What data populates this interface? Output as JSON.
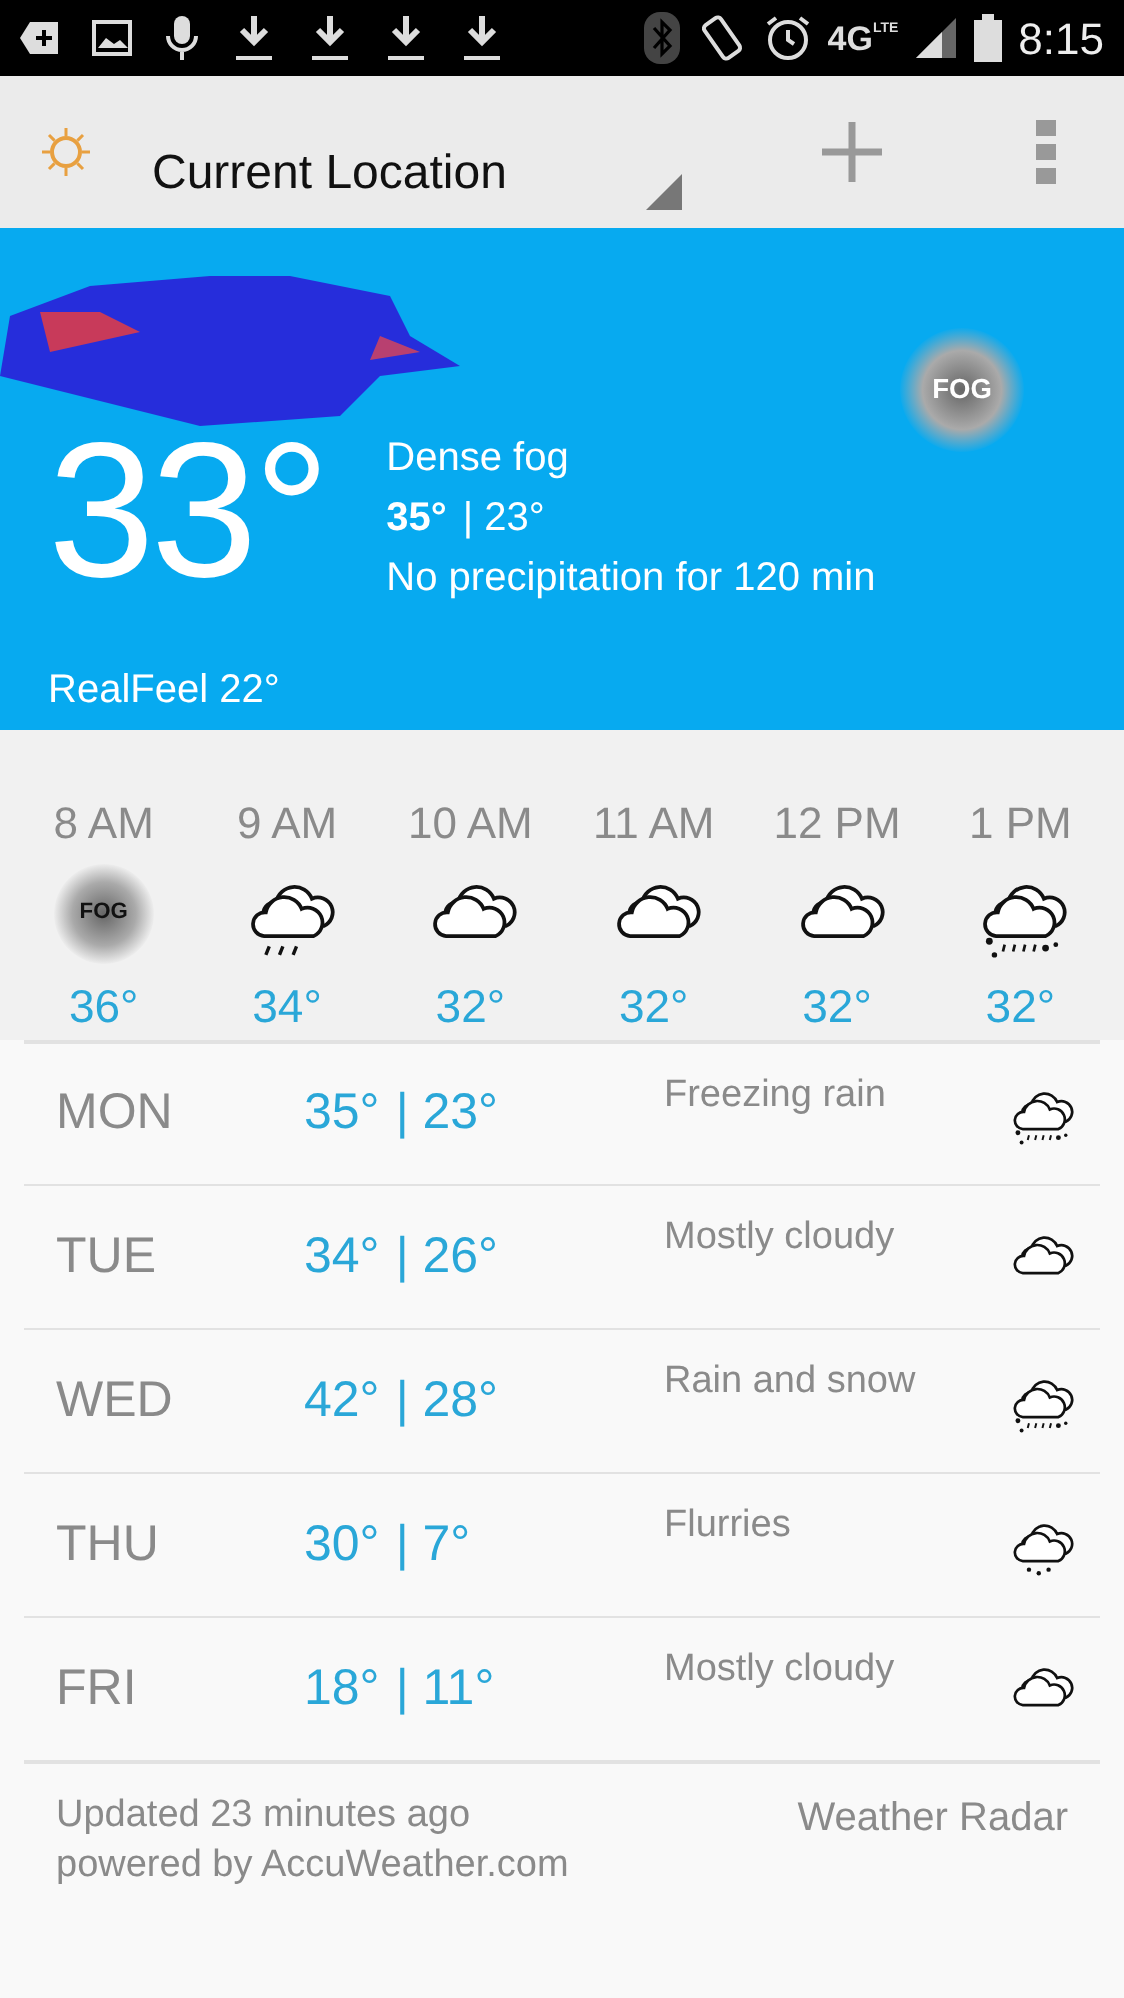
{
  "status_bar": {
    "network": "4G",
    "network_sub": "LTE",
    "time": "8:15"
  },
  "app_bar": {
    "title": "Current Location"
  },
  "current": {
    "temp": "33°",
    "condition": "Dense fog",
    "hi": "35°",
    "lo": "| 23°",
    "precipitation": "No precipitation for 120 min",
    "realfeel": "RealFeel 22°",
    "kind": "fog",
    "icon_label": "FOG"
  },
  "hourly": [
    {
      "time": "8 AM",
      "kind": "fog",
      "icon_label": "FOG",
      "temp": "36°"
    },
    {
      "time": "9 AM",
      "kind": "rain",
      "temp": "34°"
    },
    {
      "time": "10 AM",
      "kind": "cloudy",
      "temp": "32°"
    },
    {
      "time": "11 AM",
      "kind": "cloudy",
      "temp": "32°"
    },
    {
      "time": "12 PM",
      "kind": "cloudy",
      "temp": "32°"
    },
    {
      "time": "1 PM",
      "kind": "mixed",
      "temp": "32°"
    }
  ],
  "daily": [
    {
      "day": "MON",
      "hi": "35°",
      "lo": "| 23°",
      "condition": "Freezing rain",
      "kind": "mixed"
    },
    {
      "day": "TUE",
      "hi": "34°",
      "lo": "| 26°",
      "condition": "Mostly cloudy",
      "kind": "cloudy"
    },
    {
      "day": "WED",
      "hi": "42°",
      "lo": "| 28°",
      "condition": "Rain and snow",
      "kind": "mixed"
    },
    {
      "day": "THU",
      "hi": "30°",
      "lo": "| 7°",
      "condition": "Flurries",
      "kind": "flurries"
    },
    {
      "day": "FRI",
      "hi": "18°",
      "lo": "| 11°",
      "condition": "Mostly cloudy",
      "kind": "cloudy"
    }
  ],
  "footer": {
    "updated": "Updated 23 minutes ago",
    "powered_by": "powered by AccuWeather.com",
    "radar_link": "Weather Radar"
  }
}
